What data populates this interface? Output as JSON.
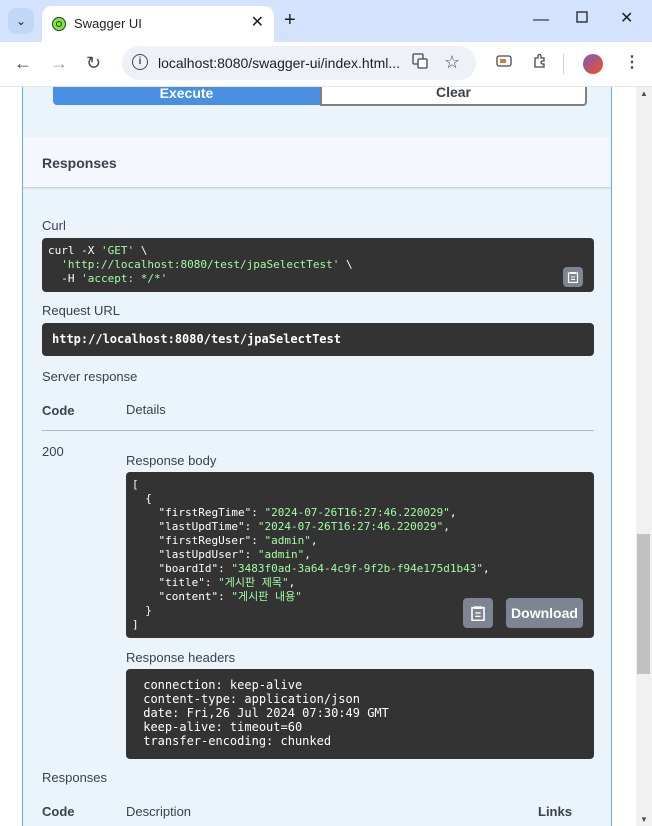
{
  "browser": {
    "tab_title": "Swagger UI",
    "url": "localhost:8080/swagger-ui/index.html...",
    "new_tab": "+",
    "close": "✕"
  },
  "actions": {
    "execute_label": "Execute",
    "clear_label": "Clear"
  },
  "responses_section": {
    "title": "Responses",
    "curl_label": "Curl",
    "curl_lines": [
      [
        "curl -X ",
        "'GET'",
        " \\"
      ],
      [
        "  ",
        "'http://localhost:8080/test/jpaSelectTest'",
        " \\"
      ],
      [
        "  -H ",
        "'accept: */*'",
        ""
      ]
    ],
    "request_url_label": "Request URL",
    "request_url": "http://localhost:8080/test/jpaSelectTest",
    "server_response_label": "Server response",
    "code_header": "Code",
    "details_header": "Details",
    "status_code": "200",
    "response_body_label": "Response body",
    "response_body_lines": [
      [
        "[",
        ""
      ],
      [
        "  {",
        ""
      ],
      [
        "    \"firstRegTime\": ",
        "\"2024-07-26T16:27:46.220029\"",
        ","
      ],
      [
        "    \"lastUpdTime\": ",
        "\"2024-07-26T16:27:46.220029\"",
        ","
      ],
      [
        "    \"firstRegUser\": ",
        "\"admin\"",
        ","
      ],
      [
        "    \"lastUpdUser\": ",
        "\"admin\"",
        ","
      ],
      [
        "    \"boardId\": ",
        "\"3483f0ad-3a64-4c9f-9f2b-f94e175d1b43\"",
        ","
      ],
      [
        "    \"title\": ",
        "\"게시판 제목\"",
        ","
      ],
      [
        "    \"content\": ",
        "\"게시판 내용\"",
        ""
      ],
      [
        "  }",
        ""
      ],
      [
        "]",
        ""
      ]
    ],
    "download_label": "Download",
    "response_headers_label": "Response headers",
    "response_headers_lines": [
      " connection: keep-alive ",
      " content-type: application/json ",
      " date: Fri,26 Jul 2024 07:30:49 GMT ",
      " keep-alive: timeout=60 ",
      " transfer-encoding: chunked "
    ],
    "responses_label": "Responses",
    "desc_code_header": "Code",
    "description_header": "Description",
    "links_header": "Links"
  }
}
